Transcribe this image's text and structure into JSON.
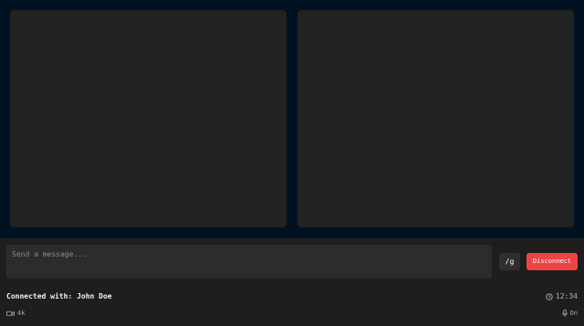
{
  "video": {
    "local_label": "",
    "remote_label": ""
  },
  "chat": {
    "placeholder": "Send a message...",
    "command_label": "/g",
    "disconnect_label": "Disconnect"
  },
  "status": {
    "connected_text": "Connected with: John Doe",
    "timer": "12:34",
    "video_quality": "4k",
    "mic_status": "On"
  },
  "icons": {
    "timer": "clock-icon",
    "quality": "camera-icon",
    "mic": "microphone-icon"
  },
  "colors": {
    "background": "#001122",
    "video_tile": "#222222",
    "panel": "#1e1e1e",
    "disconnect": "#ef4444"
  }
}
